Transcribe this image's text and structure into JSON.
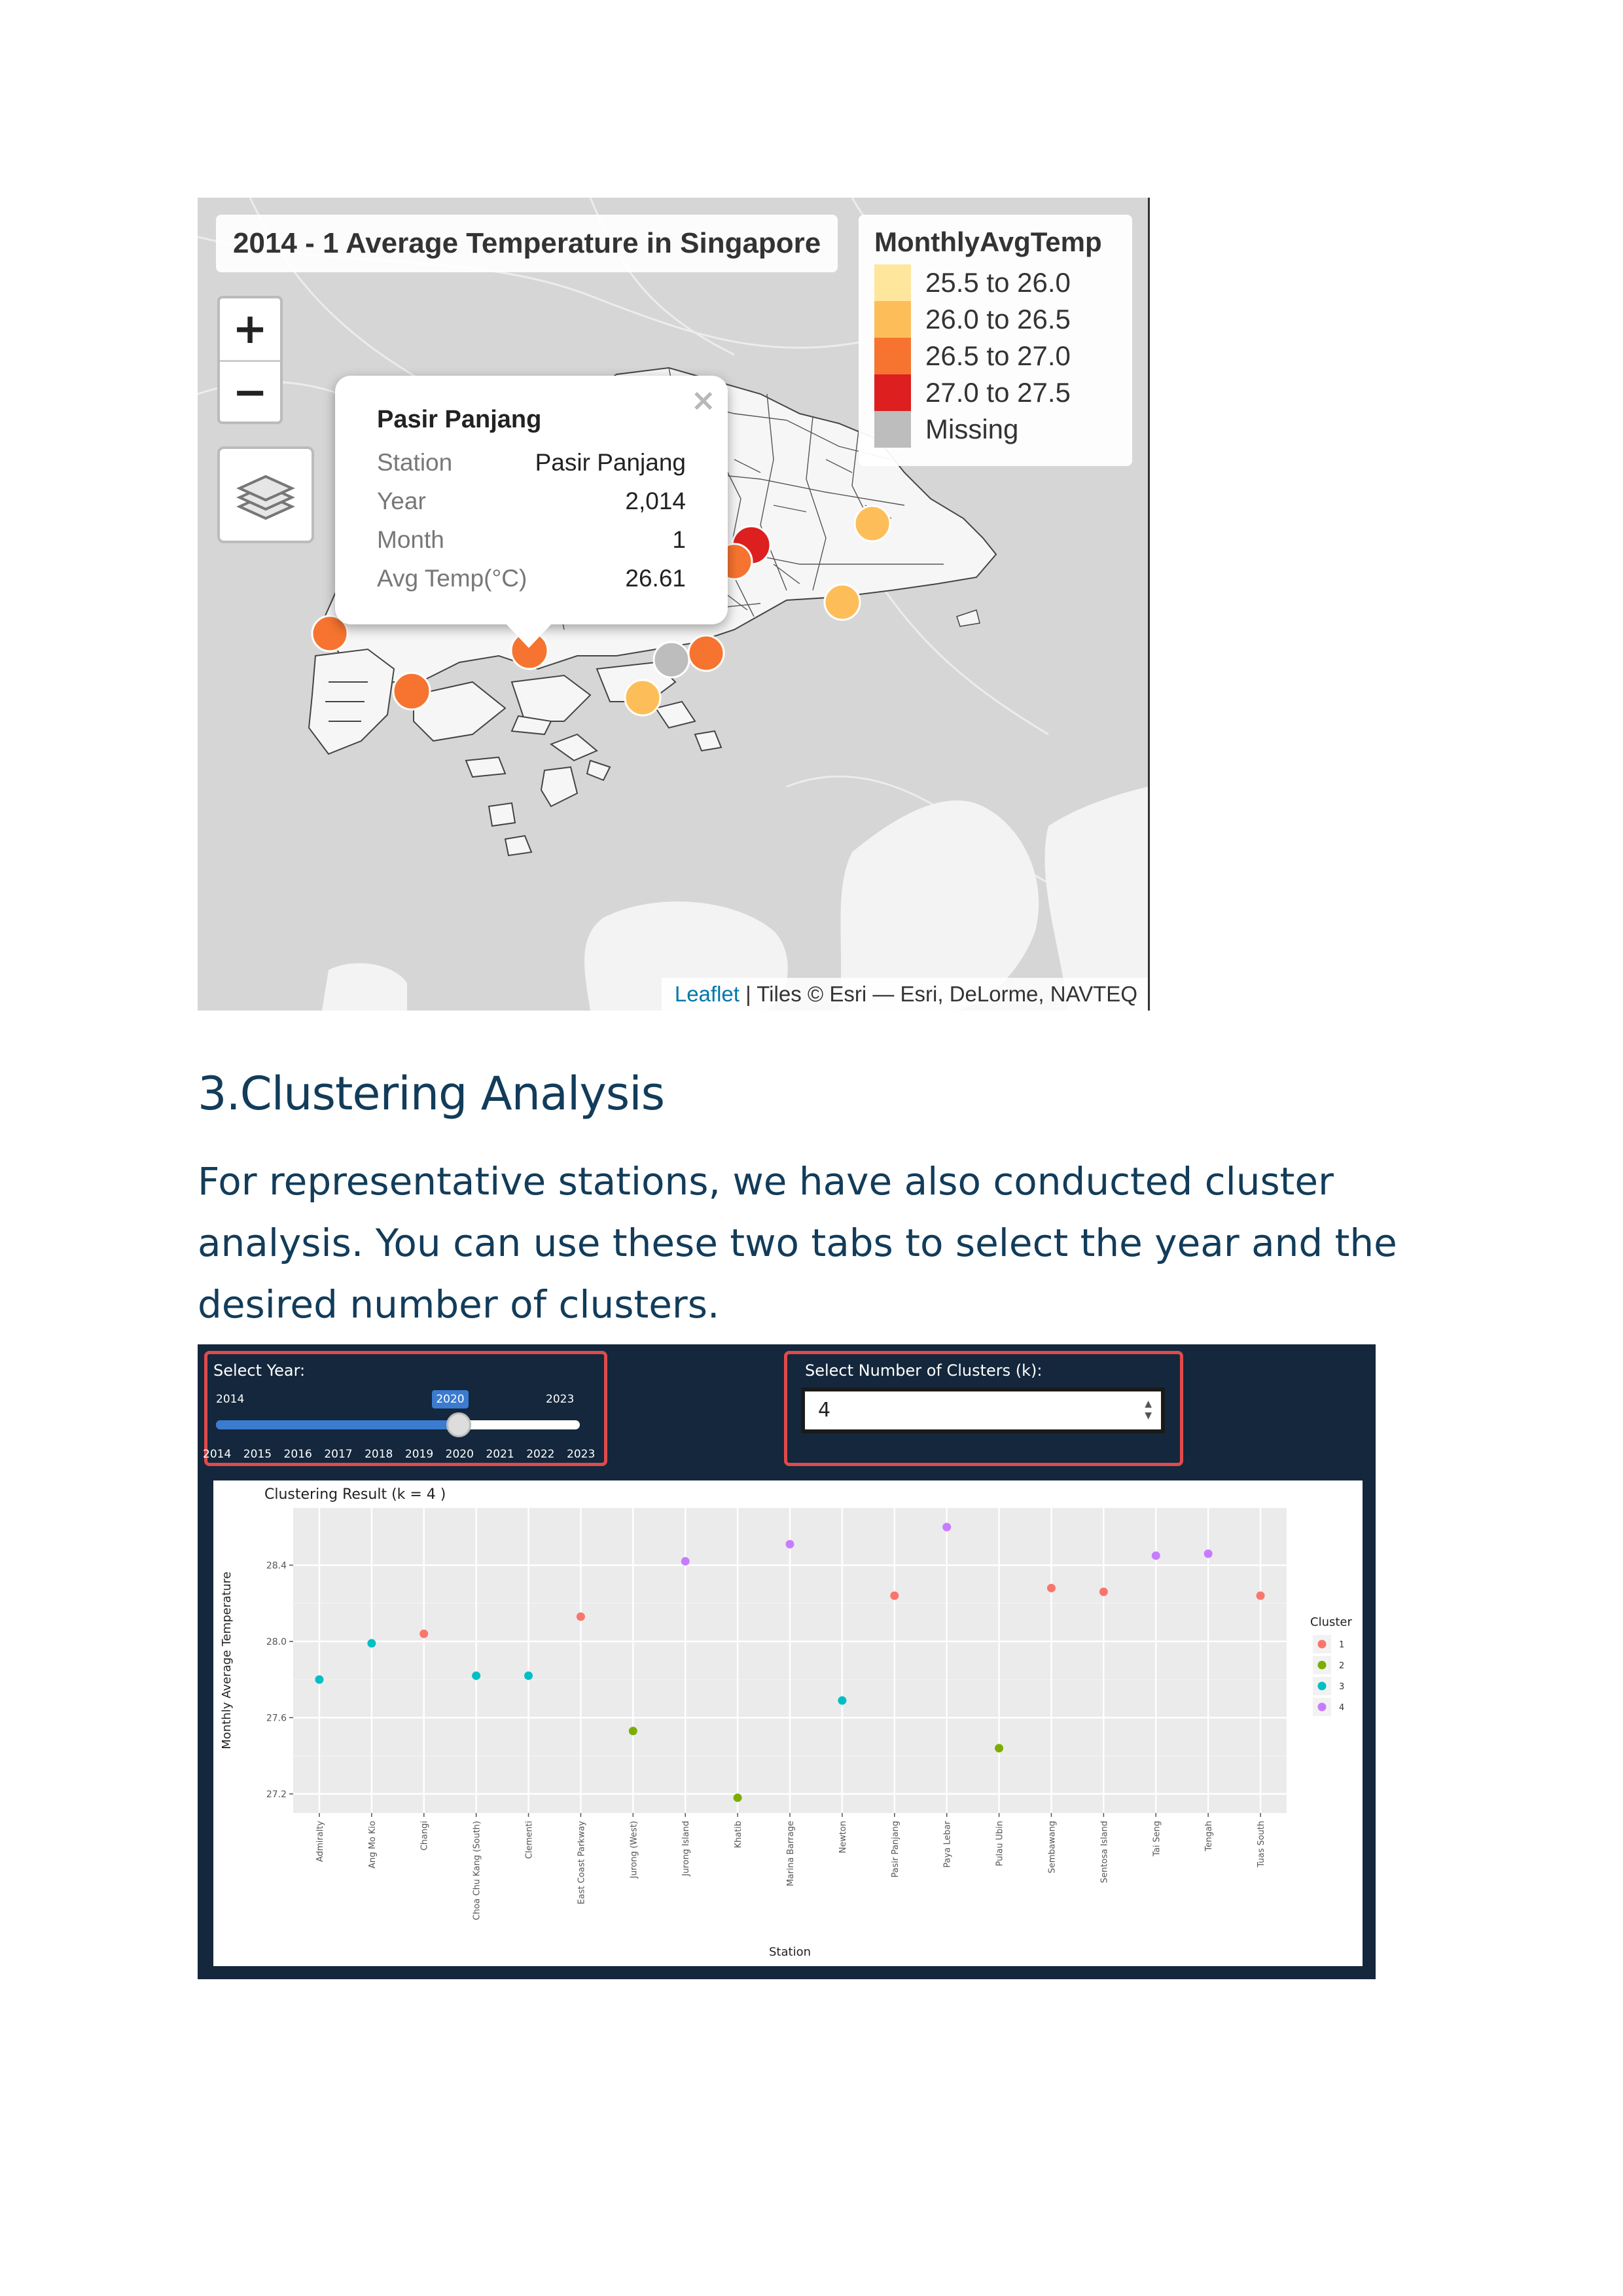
{
  "map": {
    "title": "2014 - 1 Average Temperature in Singapore",
    "zoom_in": "+",
    "zoom_out": "−",
    "legend": {
      "title": "MonthlyAvgTemp",
      "items": [
        {
          "label": "25.5 to 26.0",
          "color": "#fee79d"
        },
        {
          "label": "26.0 to 26.5",
          "color": "#fdbe59"
        },
        {
          "label": "26.5 to 27.0",
          "color": "#f6742f"
        },
        {
          "label": "27.0 to 27.5",
          "color": "#dd1f1f"
        },
        {
          "label": "Missing",
          "color": "#bdbdbd"
        }
      ]
    },
    "popup": {
      "close": "×",
      "heading": "Pasir Panjang",
      "rows": [
        {
          "key": "Station",
          "value": "Pasir Panjang"
        },
        {
          "key": "Year",
          "value": "2,014"
        },
        {
          "key": "Month",
          "value": "1"
        },
        {
          "key": "Avg Temp(°C)",
          "value": "26.61"
        }
      ]
    },
    "attribution": {
      "link": "Leaflet",
      "text": " | Tiles © Esri — Esri, DeLorme, NAVTEQ"
    }
  },
  "section": {
    "heading": "3.Clustering Analysis",
    "paragraph": "For representative stations, we have also conducted cluster analysis. You can use these two tabs to select the year and the desired number of clusters."
  },
  "controls": {
    "year_label": "Select Year:",
    "year_min": "2014",
    "year_max": "2023",
    "year_selected": "2020",
    "year_value": 2020,
    "year_ticks": [
      "2014",
      "2015",
      "2016",
      "2017",
      "2018",
      "2019",
      "2020",
      "2021",
      "2022",
      "2023"
    ],
    "k_label": "Select Number of Clusters (k):",
    "k_value": "4"
  },
  "chart_data": {
    "type": "scatter",
    "title": "Clustering Result (k = 4 )",
    "xlabel": "Station",
    "ylabel": "Monthly Average Temperature",
    "legend_title": "Cluster",
    "legend_position": "right",
    "ylim": [
      27.1,
      28.7
    ],
    "yticks": [
      27.2,
      27.6,
      28.0,
      28.4
    ],
    "ytick_labels": [
      "27.2",
      "27.6",
      "28.0",
      "28.4"
    ],
    "grid": true,
    "clusters": [
      {
        "name": "1",
        "color": "#f8766d"
      },
      {
        "name": "2",
        "color": "#7cae00"
      },
      {
        "name": "3",
        "color": "#00bfc4"
      },
      {
        "name": "4",
        "color": "#c77cff"
      }
    ],
    "categories": [
      "Admiralty",
      "Ang Mo Kio",
      "Changi",
      "Choa Chu Kang (South)",
      "Clementi",
      "East Coast Parkway",
      "Jurong (West)",
      "Jurong Island",
      "Khatib",
      "Marina Barrage",
      "Newton",
      "Pasir Panjang",
      "Paya Lebar",
      "Pulau Ubin",
      "Sembawang",
      "Sentosa Island",
      "Tai Seng",
      "Tengah",
      "Tuas South"
    ],
    "values": [
      27.8,
      27.99,
      28.04,
      27.82,
      27.82,
      28.13,
      27.53,
      28.42,
      27.18,
      28.51,
      27.69,
      28.24,
      28.6,
      27.44,
      28.28,
      28.26,
      28.45,
      28.46,
      28.24
    ],
    "cluster": [
      3,
      3,
      1,
      3,
      3,
      1,
      2,
      4,
      2,
      4,
      3,
      1,
      4,
      2,
      1,
      1,
      4,
      4,
      1
    ]
  }
}
